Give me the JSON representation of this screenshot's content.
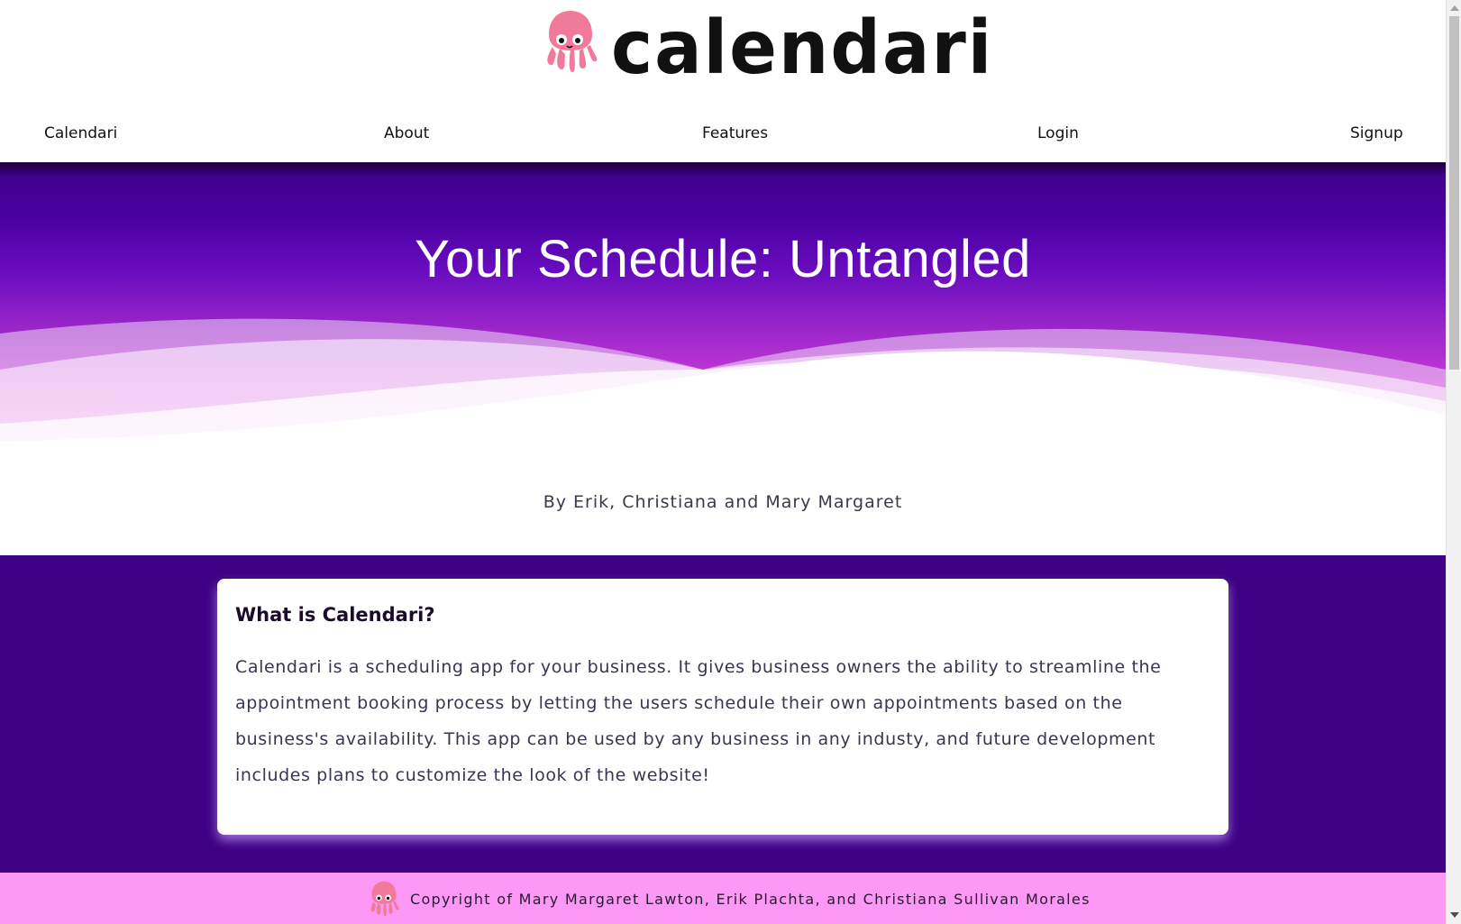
{
  "brand": {
    "logo_text": "calendari",
    "logo_icon": "squid-mascot-icon",
    "brand_color": "#f17a9a"
  },
  "nav": {
    "items": [
      {
        "label": "Calendari"
      },
      {
        "label": "About"
      },
      {
        "label": "Features"
      },
      {
        "label": "Login"
      },
      {
        "label": "Signup"
      }
    ]
  },
  "hero": {
    "title": "Your Schedule: Untangled",
    "byline": "By Erik, Christiana and Mary Margaret",
    "gradient_top": "#3d0087",
    "gradient_bottom": "#f08ded"
  },
  "about": {
    "heading": "What is Calendari?",
    "body": "Calendari is a scheduling app for your business. It gives business owners the ability to streamline the appointment booking process by letting the users schedule their own appointments based on the business's availability. This app can be used by any business in any industy, and future development includes plans to customize the look of the website!",
    "background": "#3e0084"
  },
  "footer": {
    "copyright": "Copyright of Mary Margaret Lawton, Erik Plachta, and Christiana Sullivan Morales",
    "icon": "squid-mascot-icon",
    "background": "#fd98f7"
  }
}
